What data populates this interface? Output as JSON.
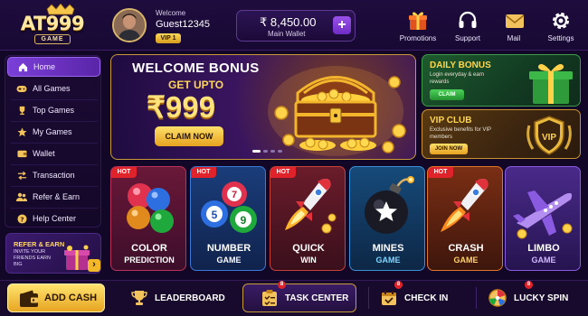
{
  "logo": {
    "text": "AT999",
    "sub": "GAME"
  },
  "user": {
    "welcome": "Welcome",
    "name": "Guest12345",
    "vip": "VIP 1"
  },
  "wallet": {
    "amount": "₹ 8,450.00",
    "label": "Main Wallet",
    "add": "+"
  },
  "header_actions": [
    {
      "label": "Promotions",
      "icon": "gift-icon"
    },
    {
      "label": "Support",
      "icon": "headset-icon"
    },
    {
      "label": "Mail",
      "icon": "mail-icon"
    },
    {
      "label": "Settings",
      "icon": "gear-icon"
    }
  ],
  "sidebar": {
    "items": [
      {
        "label": "Home",
        "icon": "home-icon",
        "active": true
      },
      {
        "label": "All Games",
        "icon": "gamepad-icon"
      },
      {
        "label": "Top Games",
        "icon": "trophy-icon"
      },
      {
        "label": "My Games",
        "icon": "star-icon"
      },
      {
        "label": "Wallet",
        "icon": "wallet-icon"
      },
      {
        "label": "Transaction",
        "icon": "transfer-icon"
      },
      {
        "label": "Refer & Earn",
        "icon": "users-icon"
      },
      {
        "label": "Help Center",
        "icon": "help-icon"
      }
    ],
    "refer": {
      "title": "REFER & EARN",
      "subtitle": "INVITE YOUR FRIENDS EARN BIG",
      "arrow": "›"
    }
  },
  "banner": {
    "title": "WELCOME BONUS",
    "subtitle": "GET UPTO",
    "amount": "₹999",
    "button": "CLAIM NOW",
    "slides": 4,
    "active_slide": 1
  },
  "promos": {
    "daily": {
      "title": "DAILY BONUS",
      "subtitle": "Login everyday & earn rewards",
      "button": "CLAIM"
    },
    "vip": {
      "title": "VIP CLUB",
      "subtitle": "Exclusive benefits for VIP members",
      "button": "JOIN NOW",
      "emblem": "VIP"
    }
  },
  "games": [
    {
      "name": "COLOR",
      "sub": "PREDICTION",
      "hot": "HOT",
      "color": "#c42a4a"
    },
    {
      "name": "NUMBER",
      "sub": "GAME",
      "hot": "HOT",
      "color": "#2b8cd8"
    },
    {
      "name": "QUICK",
      "sub": "WIN",
      "hot": "HOT",
      "color": "#c13e2a"
    },
    {
      "name": "MINES",
      "sub": "GAME",
      "hot": "",
      "color": "#1f7fb0"
    },
    {
      "name": "CRASH",
      "sub": "GAME",
      "hot": "HOT",
      "color": "#d8611d"
    },
    {
      "name": "LIMBO",
      "sub": "GAME",
      "hot": "",
      "color": "#7c48d8"
    }
  ],
  "bottom": {
    "add_cash": "ADD CASH",
    "leaderboard": "LEADERBOARD",
    "task_center": "TASK CENTER",
    "task_badge": "8",
    "check_in": "CHECK IN",
    "check_badge": "8",
    "lucky_spin": "LUCKY SPIN",
    "spin_badge": "8"
  }
}
